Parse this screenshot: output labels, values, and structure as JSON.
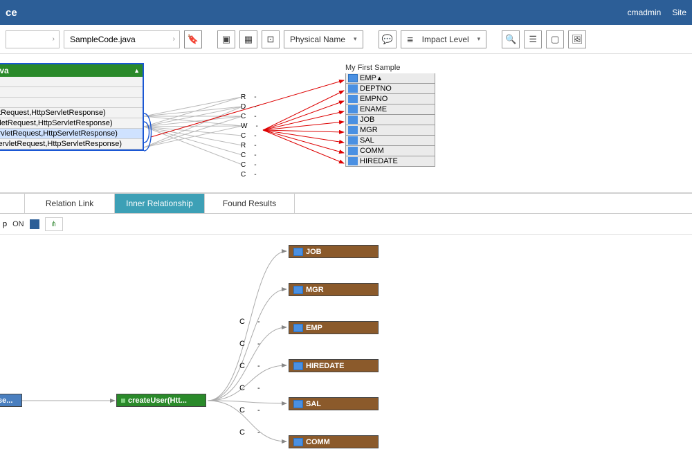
{
  "header": {
    "title_suffix": "ce",
    "user": "cmadmin",
    "right_link": "Site"
  },
  "toolbar": {
    "breadcrumb_file": "SampleCode.java",
    "name_dropdown": "Physical Name",
    "impact_dropdown": "Impact Level"
  },
  "diagram": {
    "left_node": {
      "title": ".java",
      "rows": [
        "vletRequest,HttpServletResponse)",
        "ervletRequest,HttpServletResponse)",
        "ServletRequest,HttpServletResponse)",
        "oServletRequest,HttpServletResponse)"
      ],
      "selected_row_index": 2
    },
    "right_node": {
      "supertitle": "My First Sample",
      "header": "EMP",
      "fields": [
        "DEPTNO",
        "EMPNO",
        "ENAME",
        "JOB",
        "MGR",
        "SAL",
        "COMM",
        "HIREDATE"
      ]
    },
    "mid_markers": [
      [
        "R",
        "-"
      ],
      [
        "D",
        "-"
      ],
      [
        "C",
        "-"
      ],
      [
        "W",
        "-"
      ],
      [
        "C",
        "-"
      ],
      [
        "R",
        "-"
      ],
      [
        "C",
        "-"
      ],
      [
        "C",
        "-"
      ],
      [
        "C",
        "-"
      ]
    ]
  },
  "tabs": {
    "items": [
      "Relation Link",
      "Inner Relationship",
      "Found Results"
    ],
    "active_index": 1
  },
  "subbar": {
    "prefix": "p",
    "toggle_label": "ON"
  },
  "tree": {
    "source_left": "se...",
    "source_mid": "createUser(Htt...",
    "targets": [
      "JOB",
      "MGR",
      "EMP",
      "HIREDATE",
      "SAL",
      "COMM"
    ],
    "edge_label_pairs": [
      [
        "C",
        "-"
      ],
      [
        "C",
        "-"
      ],
      [
        "C",
        "-"
      ],
      [
        "C",
        "-"
      ],
      [
        "C",
        "-"
      ],
      [
        "C",
        "-"
      ]
    ]
  }
}
